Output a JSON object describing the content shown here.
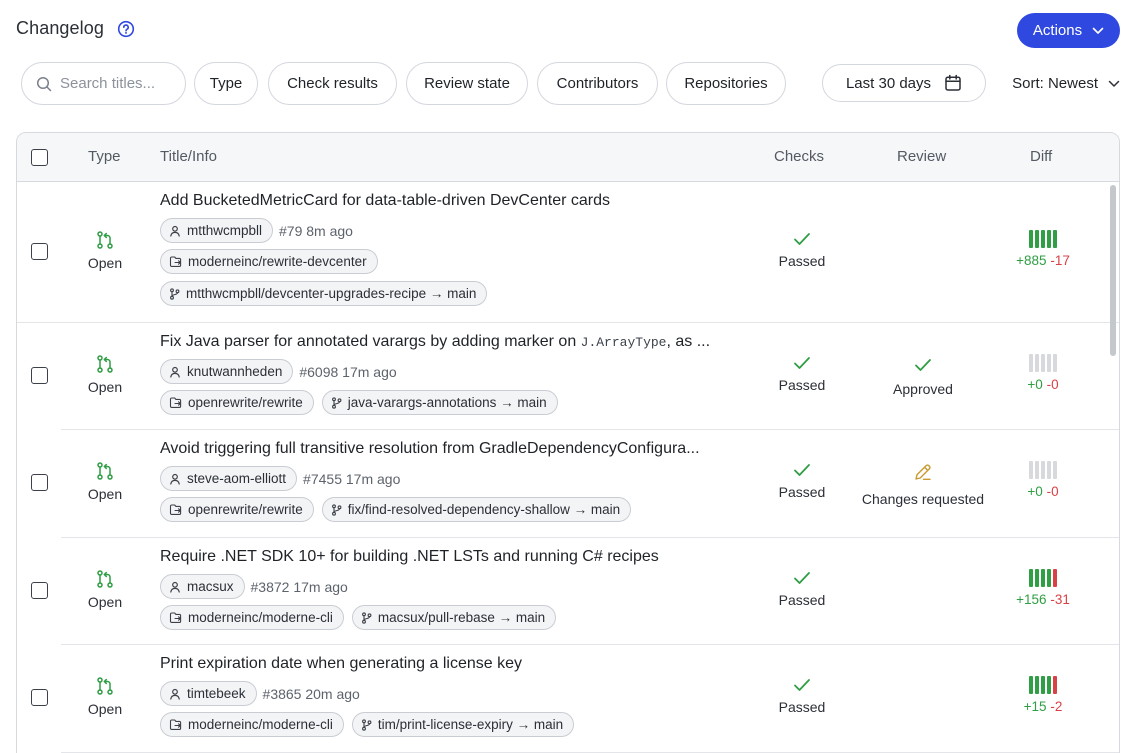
{
  "header": {
    "title": "Changelog",
    "actions_label": "Actions"
  },
  "filters": {
    "search_placeholder": "Search titles...",
    "chips": [
      "Type",
      "Check results",
      "Review state",
      "Contributors",
      "Repositories"
    ],
    "date_range": "Last 30 days",
    "sort": "Sort: Newest"
  },
  "table": {
    "columns": {
      "type": "Type",
      "title": "Title/Info",
      "checks": "Checks",
      "review": "Review",
      "diff": "Diff"
    },
    "rows": [
      {
        "type": "Open",
        "title": "Add BucketedMetricCard for data-table-driven DevCenter cards",
        "code": "",
        "title_suffix": "",
        "author": "mtthwcmpbll",
        "info": "#79 8m ago",
        "repo": "moderneinc/rewrite-devcenter",
        "branch": "mtthwcmpbll/devcenter-upgrades-recipe → main",
        "branch_on_new_line": true,
        "checks": "Passed",
        "review": "",
        "review_state": "none",
        "diff_add": "+885",
        "diff_del": "-17",
        "diff_bars": [
          "add",
          "add",
          "add",
          "add",
          "add"
        ]
      },
      {
        "type": "Open",
        "title": "Fix Java parser for annotated varargs by adding marker on ",
        "code": "J.ArrayType",
        "title_suffix": ", as ...",
        "author": "knutwannheden",
        "info": "#6098 17m ago",
        "repo": "openrewrite/rewrite",
        "branch": "java-varargs-annotations → main",
        "branch_on_new_line": false,
        "checks": "Passed",
        "review": "Approved",
        "review_state": "approved",
        "diff_add": "+0",
        "diff_del": "-0",
        "diff_bars": [
          "none",
          "none",
          "none",
          "none",
          "none"
        ]
      },
      {
        "type": "Open",
        "title": "Avoid triggering full transitive resolution from GradleDependencyConfigura...",
        "code": "",
        "title_suffix": "",
        "author": "steve-aom-elliott",
        "info": "#7455 17m ago",
        "repo": "openrewrite/rewrite",
        "branch": "fix/find-resolved-dependency-shallow → main",
        "branch_on_new_line": false,
        "checks": "Passed",
        "review": "Changes requested",
        "review_state": "changes",
        "diff_add": "+0",
        "diff_del": "-0",
        "diff_bars": [
          "none",
          "none",
          "none",
          "none",
          "none"
        ]
      },
      {
        "type": "Open",
        "title": "Require .NET SDK 10+ for building .NET LSTs and running C# recipes",
        "code": "",
        "title_suffix": "",
        "author": "macsux",
        "info": "#3872 17m ago",
        "repo": "moderneinc/moderne-cli",
        "branch": "macsux/pull-rebase → main",
        "branch_on_new_line": false,
        "checks": "Passed",
        "review": "",
        "review_state": "none",
        "diff_add": "+156",
        "diff_del": "-31",
        "diff_bars": [
          "add",
          "add",
          "add",
          "add",
          "del"
        ]
      },
      {
        "type": "Open",
        "title": "Print expiration date when generating a license key",
        "code": "",
        "title_suffix": "",
        "author": "timtebeek",
        "info": "#3865 20m ago",
        "repo": "moderneinc/moderne-cli",
        "branch": "tim/print-license-expiry → main",
        "branch_on_new_line": false,
        "checks": "Passed",
        "review": "",
        "review_state": "none",
        "diff_add": "+15",
        "diff_del": "-2",
        "diff_bars": [
          "add",
          "add",
          "add",
          "add",
          "del"
        ]
      }
    ]
  },
  "colors": {
    "accent": "#2f49e0",
    "passed": "#2f9e44",
    "changes_requested": "#c99a2e",
    "additions": "#2f9e44",
    "deletions": "#d94148",
    "neutral_bar": "#d7d9dd"
  }
}
